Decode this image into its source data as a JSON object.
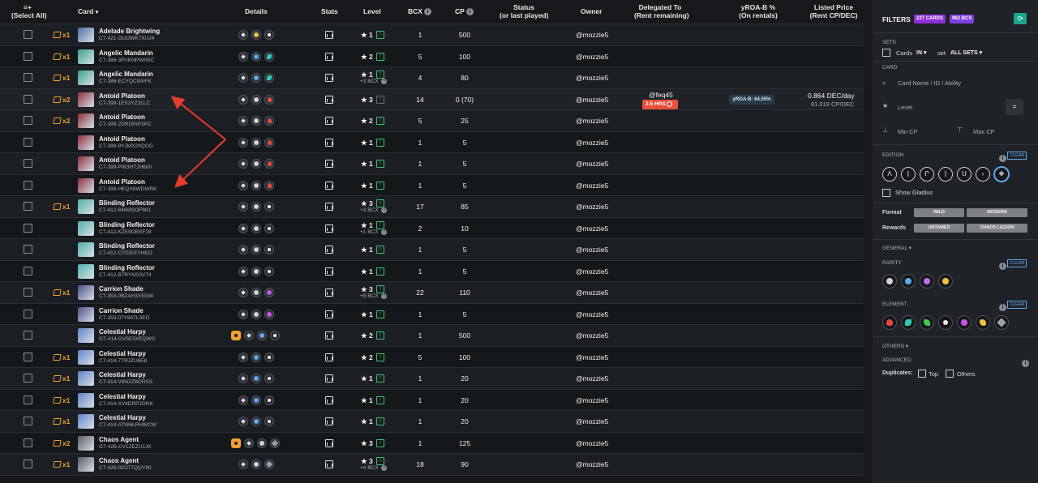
{
  "header": {
    "select_all_icon": "≡+",
    "select_all": "(Select All)",
    "card": "Card",
    "details": "Details",
    "stats": "Stats",
    "level": "Level",
    "bcx": "BCX",
    "cp": "CP",
    "status": "Status",
    "status_sub": "(or last played)",
    "owner": "Owner",
    "delegated": "Delegated To",
    "delegated_sub": "(Rent remaining)",
    "yroa": "yROA-B %",
    "yroa_sub": "(On rentals)",
    "listed": "Listed Price",
    "listed_sub": "(Rent CP/DEC)"
  },
  "rows": [
    {
      "qty": "x1",
      "name": "Adelade Brightwing",
      "uid": "C7-421-OUOWK7XUJ4",
      "icons": [
        "ed",
        "gold",
        "life"
      ],
      "foil": false,
      "level": "★ 1",
      "up": true,
      "bcx_note": "",
      "bcx": "1",
      "cp": "500",
      "owner": "@mozzie5"
    },
    {
      "qty": "x1",
      "name": "Angelic Mandarin",
      "uid": "C7-386-3PVKNPWN5C",
      "icons": [
        "ed",
        "rare",
        "water"
      ],
      "foil": false,
      "level": "★ 2",
      "up": true,
      "bcx_note": "",
      "bcx": "5",
      "cp": "100",
      "owner": "@mozzie5"
    },
    {
      "qty": "x1",
      "name": "Angelic Mandarin",
      "uid": "C7-386-ECYQC8AIFK",
      "icons": [
        "ed",
        "rare",
        "water"
      ],
      "foil": false,
      "level": "★ 1",
      "up": true,
      "bcx_note": "+3 BCX",
      "bcx": "4",
      "cp": "80",
      "owner": "@mozzie5"
    },
    {
      "qty": "x2",
      "name": "Antoid Platoon",
      "uid": "C7-399-1ES3YZ2LLC",
      "icons": [
        "ed",
        "common",
        "fire"
      ],
      "foil": false,
      "level": "★ 3",
      "up": false,
      "bcx_note": "",
      "bcx": "14",
      "cp": "0 (70)",
      "owner": "@mozzie5",
      "delegated": "@feq45",
      "rent": "2.6 HRS",
      "yroa": "yROA-B: 64.05%",
      "price1": "0.864 DEC/day",
      "price2": "81.019 CP/DEC"
    },
    {
      "qty": "x2",
      "name": "Antoid Platoon",
      "uid": "C7-399-2DRDRIP3PC",
      "icons": [
        "ed",
        "common",
        "fire"
      ],
      "foil": false,
      "level": "★ 2",
      "up": true,
      "bcx_note": "",
      "bcx": "5",
      "cp": "25",
      "owner": "@mozzie5"
    },
    {
      "qty": "",
      "name": "Antoid Platoon",
      "uid": "C7-399-9YJMX29QOG",
      "icons": [
        "ed",
        "common",
        "fire"
      ],
      "foil": false,
      "level": "★ 1",
      "up": true,
      "bcx_note": "",
      "bcx": "1",
      "cp": "5",
      "owner": "@mozzie5"
    },
    {
      "qty": "",
      "name": "Antoid Platoon",
      "uid": "C7-399-PW3HTJH600",
      "icons": [
        "ed",
        "common",
        "fire"
      ],
      "foil": false,
      "level": "★ 1",
      "up": true,
      "bcx_note": "",
      "bcx": "1",
      "cp": "5",
      "owner": "@mozzie5"
    },
    {
      "qty": "",
      "name": "Antoid Platoon",
      "uid": "C7-399-HEQX6WDWRK",
      "icons": [
        "ed",
        "common",
        "fire"
      ],
      "foil": false,
      "level": "★ 1",
      "up": true,
      "bcx_note": "",
      "bcx": "1",
      "cp": "5",
      "owner": "@mozzie5"
    },
    {
      "qty": "x1",
      "name": "Blinding Reflector",
      "uid": "C7-412-8469ISOFMO",
      "icons": [
        "ed",
        "common",
        "life"
      ],
      "foil": false,
      "level": "★ 3",
      "up": true,
      "bcx_note": "+3 BCX",
      "bcx": "17",
      "cp": "85",
      "owner": "@mozzie5"
    },
    {
      "qty": "",
      "name": "Blinding Reflector",
      "uid": "C7-412-KZE9OBSF28",
      "icons": [
        "ed",
        "common",
        "life"
      ],
      "foil": false,
      "level": "★ 1",
      "up": true,
      "bcx_note": "+1 BCX",
      "bcx": "2",
      "cp": "10",
      "owner": "@mozzie5"
    },
    {
      "qty": "",
      "name": "Blinding Reflector",
      "uid": "C7-412-CITDEEYHEO",
      "icons": [
        "ed",
        "common",
        "life"
      ],
      "foil": false,
      "level": "★ 1",
      "up": true,
      "bcx_note": "",
      "bcx": "1",
      "cp": "5",
      "owner": "@mozzie5"
    },
    {
      "qty": "",
      "name": "Blinding Reflector",
      "uid": "C7-412-B7RYNS3V74",
      "icons": [
        "ed",
        "common",
        "life"
      ],
      "foil": false,
      "level": "★ 1",
      "up": true,
      "bcx_note": "",
      "bcx": "1",
      "cp": "5",
      "owner": "@mozzie5"
    },
    {
      "qty": "x1",
      "name": "Carrion Shade",
      "uid": "C7-353-0BZAH3X5GW",
      "icons": [
        "ed",
        "common",
        "death"
      ],
      "foil": false,
      "level": "★ 3",
      "up": true,
      "bcx_note": "+8 BCX",
      "bcx": "22",
      "cp": "110",
      "owner": "@mozzie5"
    },
    {
      "qty": "",
      "name": "Carrion Shade",
      "uid": "C7-353-07Y847L0EO",
      "icons": [
        "ed",
        "common",
        "death"
      ],
      "foil": false,
      "level": "★ 1",
      "up": true,
      "bcx_note": "",
      "bcx": "1",
      "cp": "5",
      "owner": "@mozzie5"
    },
    {
      "qty": "",
      "name": "Celestial Harpy",
      "uid": "G7-414-GV5E3XEQWG",
      "icons": [
        "ed",
        "rare",
        "life"
      ],
      "foil": true,
      "level": "★ 2",
      "up": true,
      "bcx_note": "",
      "bcx": "1",
      "cp": "500",
      "owner": "@mozzie5"
    },
    {
      "qty": "x1",
      "name": "Celestial Harpy",
      "uid": "C7-414-7TRJZU6E8",
      "icons": [
        "ed",
        "rare",
        "life"
      ],
      "foil": false,
      "level": "★ 2",
      "up": true,
      "bcx_note": "",
      "bcx": "5",
      "cp": "100",
      "owner": "@mozzie5"
    },
    {
      "qty": "x1",
      "name": "Celestial Harpy",
      "uid": "C7-414-V6N2ZBDRSS",
      "icons": [
        "ed",
        "rare",
        "life"
      ],
      "foil": false,
      "level": "★ 1",
      "up": true,
      "bcx_note": "",
      "bcx": "1",
      "cp": "20",
      "owner": "@mozzie5"
    },
    {
      "qty": "x1",
      "name": "Celestial Harpy",
      "uid": "C7-414-XV4DRPJORK",
      "icons": [
        "ed",
        "rare",
        "life"
      ],
      "foil": false,
      "level": "★ 1",
      "up": true,
      "bcx_note": "",
      "bcx": "1",
      "cp": "20",
      "owner": "@mozzie5"
    },
    {
      "qty": "x1",
      "name": "Celestial Harpy",
      "uid": "C7-414-ATW6LRHWCW",
      "icons": [
        "ed",
        "rare",
        "life"
      ],
      "foil": false,
      "level": "★ 1",
      "up": true,
      "bcx_note": "",
      "bcx": "1",
      "cp": "20",
      "owner": "@mozzie5"
    },
    {
      "qty": "x2",
      "name": "Chaos Agent",
      "uid": "G7-426-CV1ZEZU1JK",
      "icons": [
        "ed",
        "common",
        "neutral"
      ],
      "foil": true,
      "level": "★ 3",
      "up": true,
      "bcx_note": "",
      "bcx": "1",
      "cp": "125",
      "owner": "@mozzie5"
    },
    {
      "qty": "x1",
      "name": "Chaos Agent",
      "uid": "C7-426-0ZU77QQY80",
      "icons": [
        "ed",
        "common",
        "neutral"
      ],
      "foil": false,
      "level": "★ 3",
      "up": true,
      "bcx_note": "+4 BCX",
      "bcx": "18",
      "cp": "90",
      "owner": "@mozzie5"
    }
  ],
  "filters": {
    "title": "FILTERS",
    "cards_count": "227 CARDS",
    "bcx_count": "962 BCX",
    "refresh_icon": "⟳",
    "sets_label": "SETS",
    "cards_label": "Cards",
    "in_select": "IN",
    "set_label": "set",
    "all_sets": "ALL SETS",
    "card_label": "CARD",
    "card_placeholder": "Card Name / ID / Ability",
    "level_label": "Level",
    "level_value": "=",
    "min_cp": "Min CP",
    "max_cp": "Max CP",
    "edition_label": "EDITION",
    "clear": "CLEAR",
    "edition_icons": [
      "alpha-icon",
      "beta-icon",
      "promo-icon",
      "reward-icon",
      "untamed-icon",
      "dice-icon",
      "chaos-icon"
    ],
    "edition_glyphs": [
      "Λ",
      "ᛒ",
      "Ր",
      "ᚱ",
      "Ս",
      "›",
      "✥"
    ],
    "show_gladius": "Show Gladius",
    "format_label": "Format",
    "wild": "WILD",
    "modern": "MODERN",
    "rewards_label": "Rewards",
    "untamed": "UNTAMED",
    "chaos_legion": "CHAOS LEGION",
    "general_label": "GENERAL",
    "rarity_label": "RARITY",
    "element_label": "ELEMENT",
    "others_label": "OTHERS",
    "advanced_label": "ADVANCED",
    "duplicates_label": "Duplicates:",
    "top_label": "Top",
    "others_cb_label": "Others"
  },
  "colors": {
    "accent_orange": "#f0a130",
    "green": "#3ec26b",
    "rent_badge": "#e8503a",
    "cards_tag": "#8e2fd6",
    "bcx_tag": "#7b3fe0",
    "refresh": "#1aa58c"
  }
}
